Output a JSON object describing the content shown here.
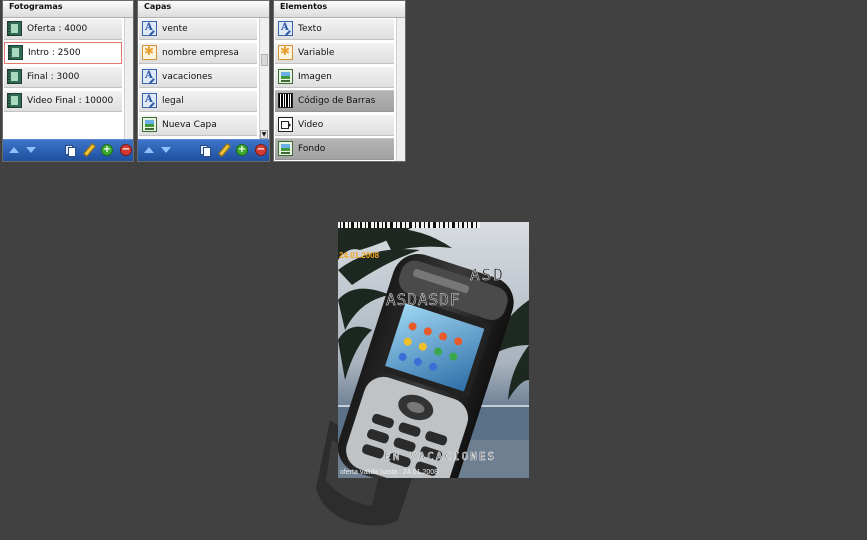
{
  "panels": {
    "fotogramas": {
      "title": "Fotogramas",
      "items": [
        {
          "label": "Oferta : 4000",
          "icon": "film-frame-icon"
        },
        {
          "label": "Intro : 2500",
          "icon": "film-frame-icon",
          "selected": true
        },
        {
          "label": "Final : 3000",
          "icon": "film-frame-icon"
        },
        {
          "label": "Video Final : 10000",
          "icon": "film-frame-icon"
        }
      ]
    },
    "capas": {
      "title": "Capas",
      "items": [
        {
          "label": "vente",
          "icon": "text-layer-icon"
        },
        {
          "label": "nombre empresa",
          "icon": "variable-icon"
        },
        {
          "label": "vacaciones",
          "icon": "text-layer-icon"
        },
        {
          "label": "legal",
          "icon": "text-layer-icon"
        },
        {
          "label": "Nueva Capa",
          "icon": "image-icon"
        }
      ]
    },
    "elementos": {
      "title": "Elementos",
      "items": [
        {
          "label": "Texto",
          "icon": "text-layer-icon"
        },
        {
          "label": "Variable",
          "icon": "variable-icon"
        },
        {
          "label": "Imagen",
          "icon": "image-icon"
        },
        {
          "label": "Código de Barras",
          "icon": "barcode-icon",
          "dark": true
        },
        {
          "label": "Video",
          "icon": "video-icon"
        },
        {
          "label": "Fondo",
          "icon": "image-icon",
          "dark": true
        }
      ]
    }
  },
  "toolbar_icons": [
    "move-up-icon",
    "move-down-icon",
    "duplicate-icon",
    "edit-pencil-icon",
    "add-icon",
    "delete-icon"
  ],
  "preview": {
    "date": "24.01.2008",
    "headline_1": "ASD",
    "headline_2": "ASDASDF",
    "tagline": "EN VACACIONES",
    "legal": "oferta valida hasta : 24.01.2008"
  },
  "colors": {
    "background": "#414141",
    "toolbar": "#2a5bb0",
    "selection_border": "#e0796d",
    "date_text": "#f2a51e"
  }
}
